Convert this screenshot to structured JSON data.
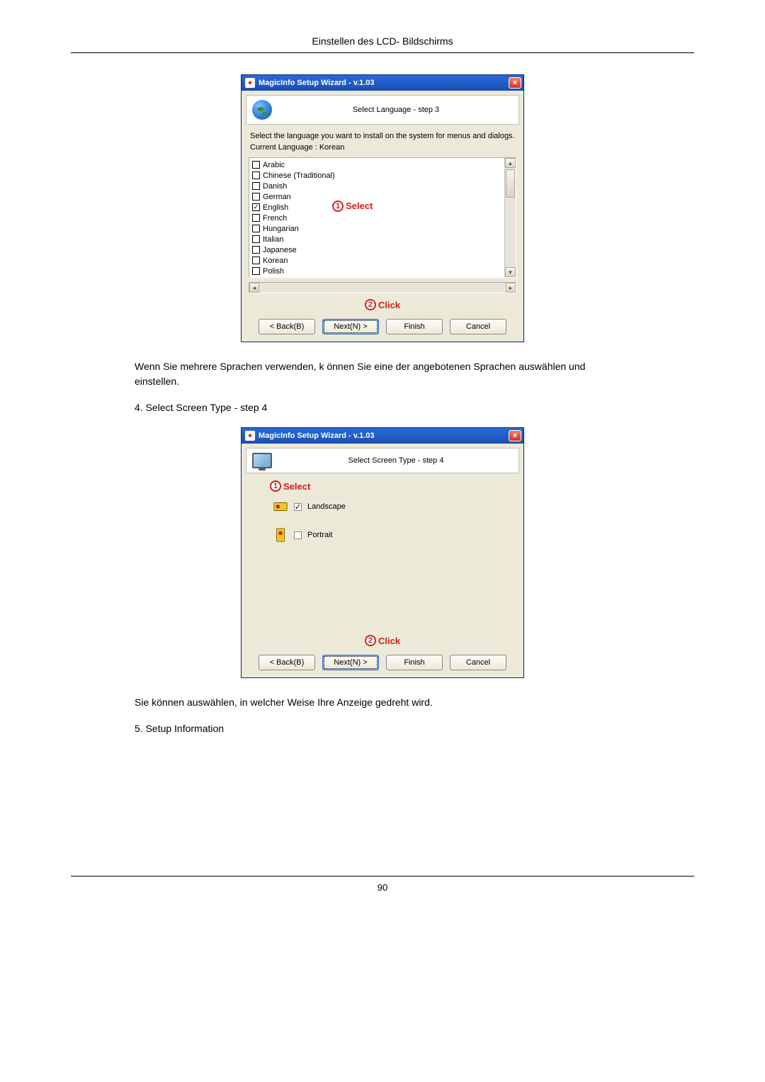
{
  "header": {
    "title": "Einstellen des LCD- Bildschirms"
  },
  "dialog1": {
    "window_title": "MagicInfo Setup Wizard - v.1.03",
    "step_title": "Select Language - step 3",
    "desc": "Select the language you want to install on the system for menus and dialogs.",
    "current_lang_label": "Current Language  :  Korean",
    "languages": [
      {
        "label": "Arabic",
        "checked": false
      },
      {
        "label": "Chinese (Traditional)",
        "checked": false
      },
      {
        "label": "Danish",
        "checked": false
      },
      {
        "label": "German",
        "checked": false
      },
      {
        "label": "English",
        "checked": true
      },
      {
        "label": "French",
        "checked": false
      },
      {
        "label": "Hungarian",
        "checked": false
      },
      {
        "label": "Italian",
        "checked": false
      },
      {
        "label": "Japanese",
        "checked": false
      },
      {
        "label": "Korean",
        "checked": false
      },
      {
        "label": "Polish",
        "checked": false
      }
    ],
    "callout_select": "Select",
    "callout_click": "Click",
    "buttons": {
      "back": "< Back(B)",
      "next": "Next(N) >",
      "finish": "Finish",
      "cancel": "Cancel"
    }
  },
  "para1": "Wenn Sie mehrere Sprachen verwenden, k önnen Sie eine der angebotenen Sprachen auswählen und einstellen.",
  "step4_heading": "4. Select Screen Type -  step 4",
  "dialog2": {
    "window_title": "MagicInfo Setup Wizard - v.1.03",
    "step_title": "Select Screen Type - step 4",
    "callout_select": "Select",
    "options": {
      "landscape": {
        "label": "Landscape",
        "checked": true
      },
      "portrait": {
        "label": "Portrait",
        "checked": false
      }
    },
    "callout_click": "Click",
    "buttons": {
      "back": "< Back(B)",
      "next": "Next(N) >",
      "finish": "Finish",
      "cancel": "Cancel"
    }
  },
  "para2": "Sie können auswählen, in welcher Weise Ihre Anzeige gedreht wird.",
  "step5_heading": "5. Setup Information",
  "footer": {
    "page": "90"
  }
}
